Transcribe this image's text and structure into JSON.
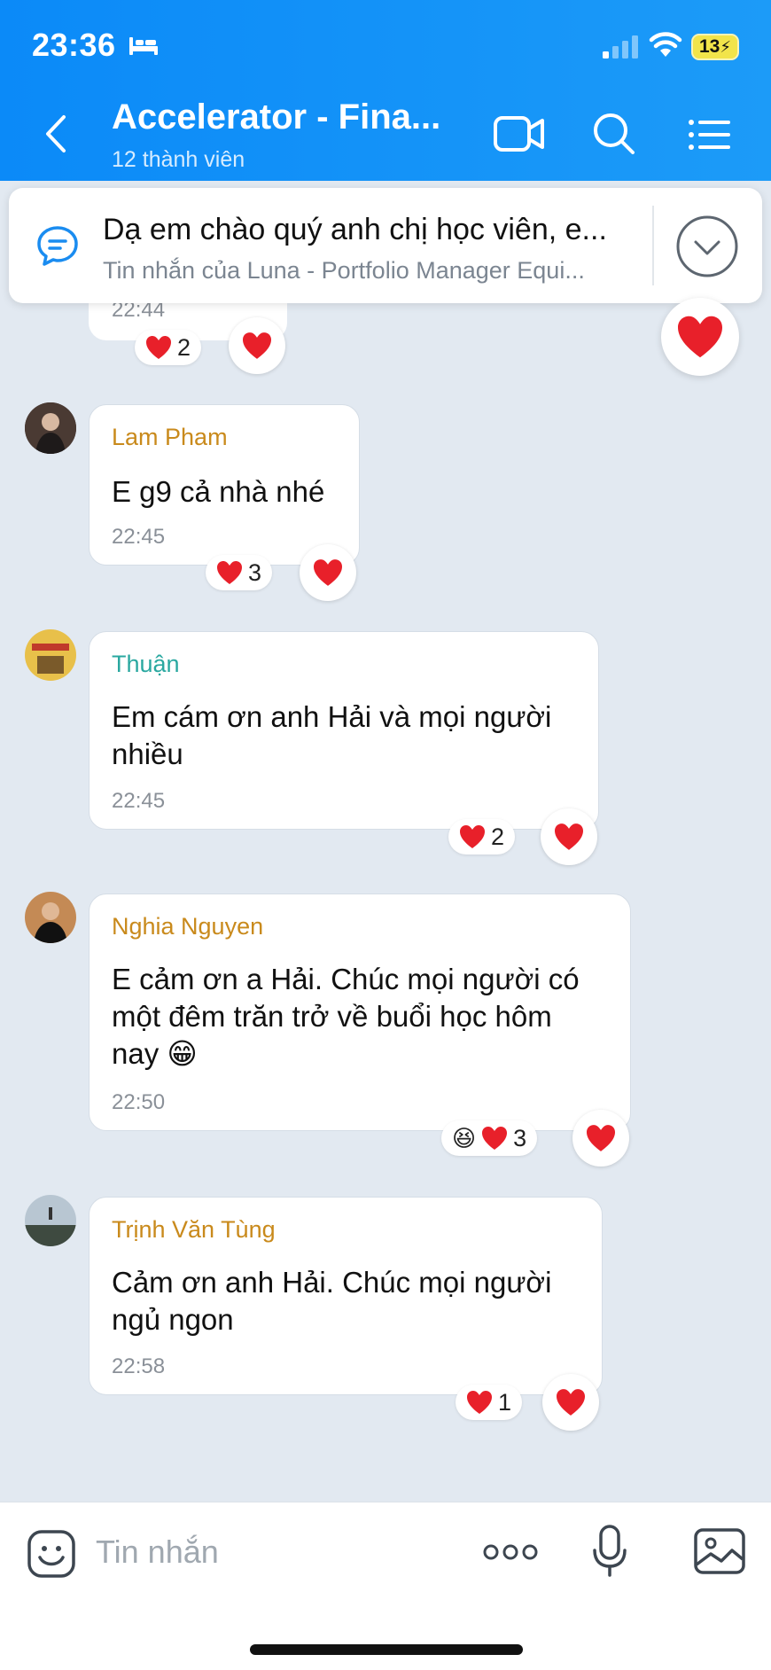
{
  "status_bar": {
    "time": "23:36",
    "battery": "13"
  },
  "header": {
    "title": "Accelerator - Fina...",
    "subtitle": "12 thành viên"
  },
  "pinned": {
    "title": "Dạ em chào quý anh chị học viên, e...",
    "subtitle": "Tin nhắn của Luna - Portfolio Manager Equi..."
  },
  "previous_message": {
    "time": "22:44",
    "reaction_count": "2"
  },
  "messages": [
    {
      "sender": "Lam Pham",
      "sender_color": "#c98a1c",
      "lines": [
        "E g9 cả nhà nhé"
      ],
      "time": "22:45",
      "reaction_count": "3",
      "reactions": [
        "heart"
      ]
    },
    {
      "sender": "Thuận",
      "sender_color": "#2aa8a0",
      "lines": [
        "Em cám ơn anh Hải và mọi người",
        "nhiều"
      ],
      "time": "22:45",
      "reaction_count": "2",
      "reactions": [
        "heart"
      ]
    },
    {
      "sender": "Nghia Nguyen",
      "sender_color": "#c98a1c",
      "lines": [
        "E cảm ơn a Hải. Chúc mọi người có",
        "một đêm trăn trở về buổi học hôm",
        "nay 😁"
      ],
      "time": "22:50",
      "reaction_count": "3",
      "reactions": [
        "laugh",
        "heart"
      ]
    },
    {
      "sender": "Trịnh Văn Tùng",
      "sender_color": "#c98a1c",
      "lines": [
        "Cảm ơn anh Hải. Chúc mọi người",
        "ngủ ngon"
      ],
      "time": "22:58",
      "reaction_count": "1",
      "reactions": [
        "heart"
      ]
    }
  ],
  "input": {
    "placeholder": "Tin nhắn"
  },
  "colors": {
    "header_bg": "#0b8af8",
    "chat_bg": "#e2e9f1",
    "heart": "#e8202a"
  },
  "icons": [
    "bed-icon",
    "signal-icon",
    "wifi-icon",
    "back-icon",
    "video-call-icon",
    "search-icon",
    "menu-icon",
    "chat-bubble-icon",
    "chevron-down-icon",
    "heart-icon",
    "sticker-icon",
    "more-icon",
    "mic-icon",
    "image-icon"
  ]
}
